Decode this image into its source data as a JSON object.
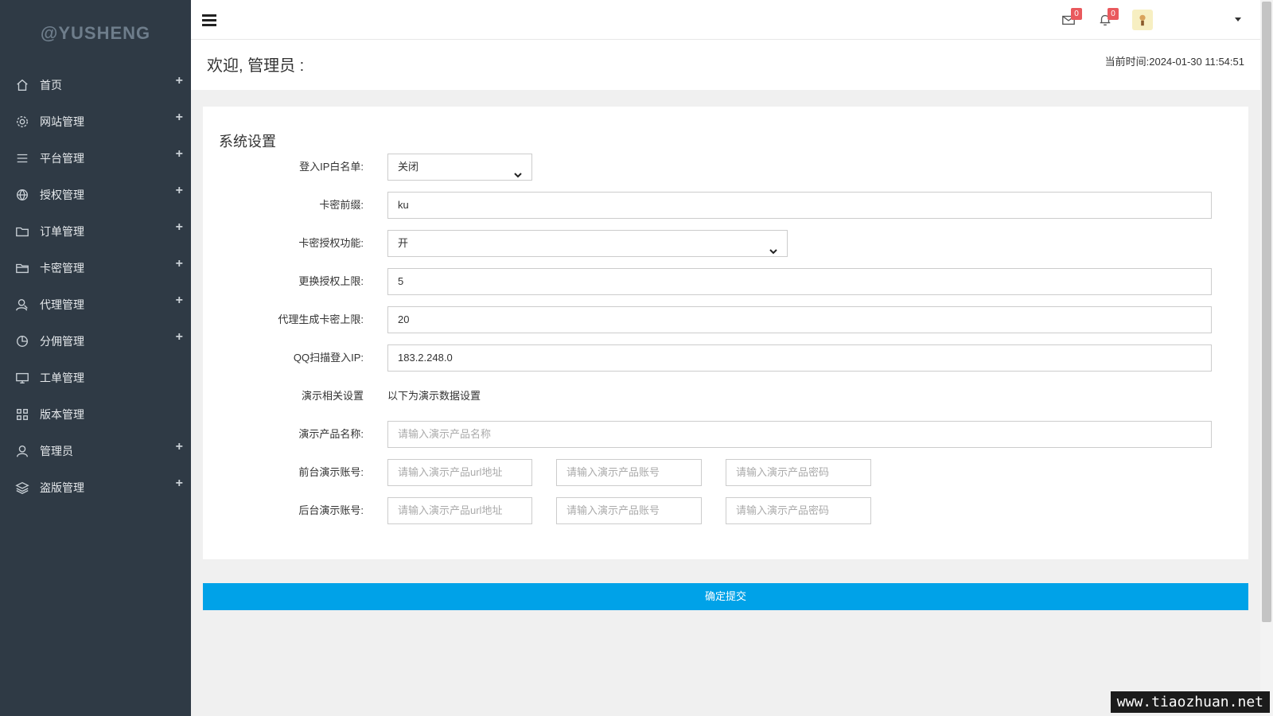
{
  "sidebar": {
    "logo": "@YUSHENG",
    "items": [
      {
        "label": "首页",
        "icon": "home-icon",
        "expandable": true
      },
      {
        "label": "网站管理",
        "icon": "gear-icon",
        "expandable": true
      },
      {
        "label": "平台管理",
        "icon": "list-icon",
        "expandable": true
      },
      {
        "label": "授权管理",
        "icon": "ball-icon",
        "expandable": true
      },
      {
        "label": "订单管理",
        "icon": "folder-icon",
        "expandable": true
      },
      {
        "label": "卡密管理",
        "icon": "folder-icon",
        "expandable": true
      },
      {
        "label": "代理管理",
        "icon": "user-group-icon",
        "expandable": true
      },
      {
        "label": "分佣管理",
        "icon": "pie-icon",
        "expandable": true
      },
      {
        "label": "工单管理",
        "icon": "monitor-icon",
        "expandable": false
      },
      {
        "label": "版本管理",
        "icon": "grid-icon",
        "expandable": false
      },
      {
        "label": "管理员",
        "icon": "user-icon",
        "expandable": true
      },
      {
        "label": "盗版管理",
        "icon": "layers-icon",
        "expandable": true
      }
    ],
    "plus_glyph": "+"
  },
  "topbar": {
    "mail_badge": "0",
    "bell_badge": "0"
  },
  "welcome": {
    "title": "欢迎, 管理员 :",
    "time": "当前时间:2024-01-30 11:54:51"
  },
  "form": {
    "title": "系统设置",
    "ip_whitelist": {
      "label": "登入IP白名单:",
      "value": "关闭"
    },
    "card_prefix": {
      "label": "卡密前缀:",
      "value": "ku"
    },
    "card_auth": {
      "label": "卡密授权功能:",
      "value": "开"
    },
    "auth_change_limit": {
      "label": "更换授权上限:",
      "value": "5"
    },
    "agent_card_limit": {
      "label": "代理生成卡密上限:",
      "value": "20"
    },
    "qq_scan_ip": {
      "label": "QQ扫描登入IP:",
      "value": "183.2.248.0"
    },
    "demo_settings": {
      "label": "演示相关设置",
      "text": "以下为演示数据设置"
    },
    "demo_product_name": {
      "label": "演示产品名称:",
      "placeholder": "请输入演示产品名称"
    },
    "front_demo": {
      "label": "前台演示账号:",
      "url_placeholder": "请输入演示产品url地址",
      "account_placeholder": "请输入演示产品账号",
      "password_placeholder": "请输入演示产品密码"
    },
    "back_demo": {
      "label": "后台演示账号:",
      "url_placeholder": "请输入演示产品url地址",
      "account_placeholder": "请输入演示产品账号",
      "password_placeholder": "请输入演示产品密码"
    },
    "submit_label": "确定提交"
  },
  "watermark": "www.tiaozhuan.net",
  "colors": {
    "sidebar_bg": "#2f3a45",
    "accent": "#00a2e8",
    "badge": "#e9595d"
  }
}
